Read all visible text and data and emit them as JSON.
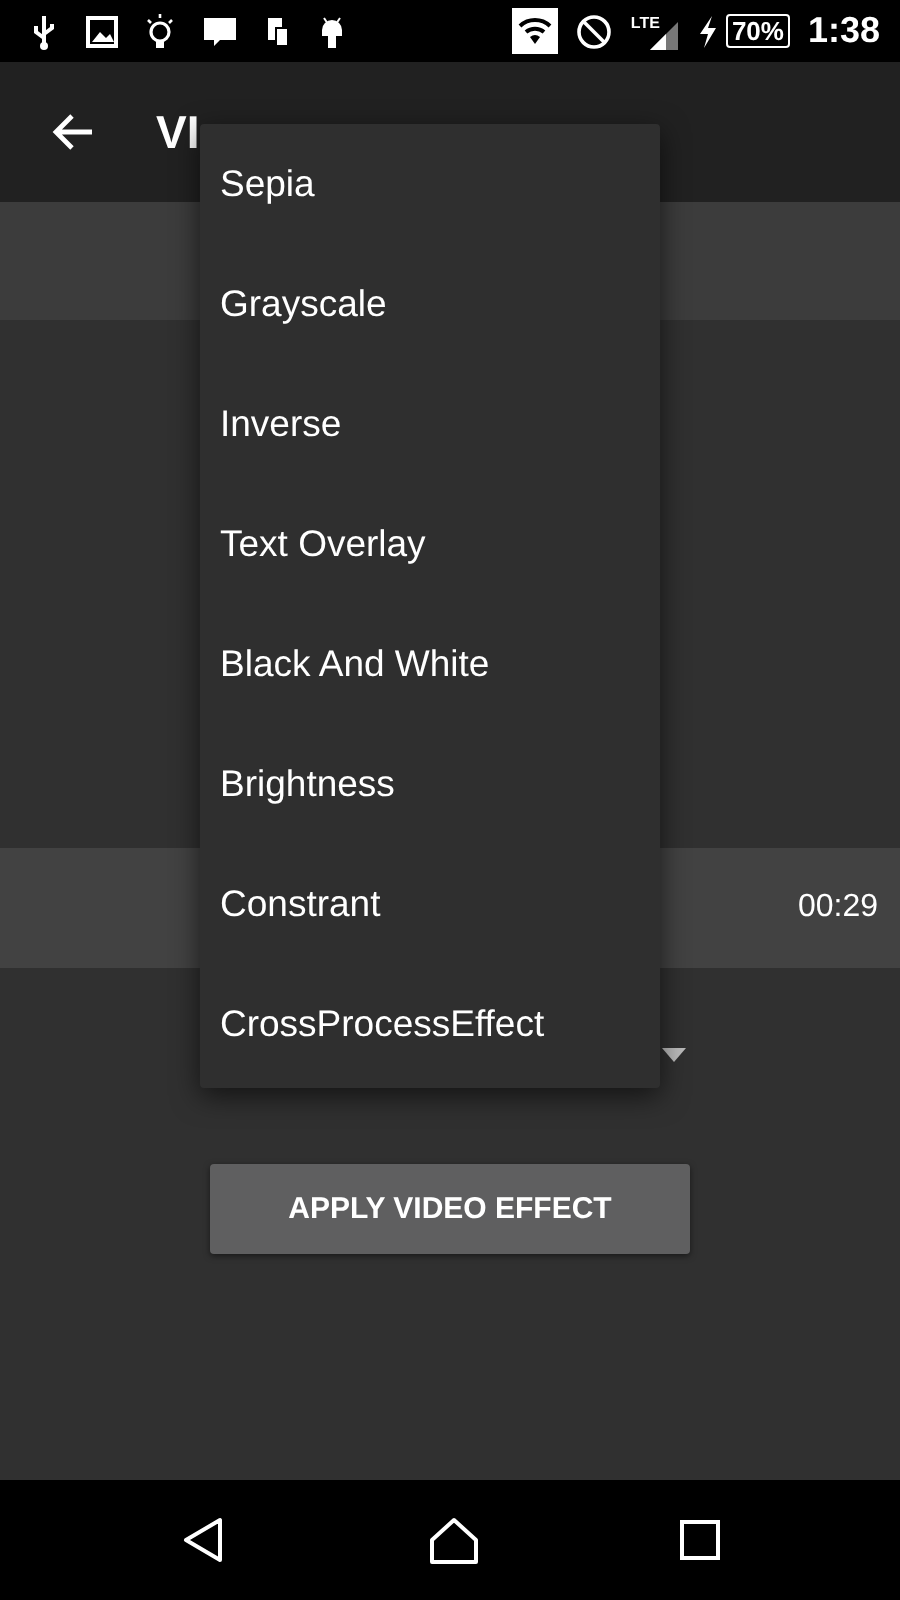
{
  "status_bar": {
    "network": "LTE",
    "battery": "70%",
    "time": "1:38"
  },
  "app_bar": {
    "title": "VI"
  },
  "video_row": {
    "duration": "00:29"
  },
  "effect_menu": {
    "items": [
      {
        "label": "Sepia"
      },
      {
        "label": "Grayscale"
      },
      {
        "label": "Inverse"
      },
      {
        "label": "Text Overlay"
      },
      {
        "label": "Black And White"
      },
      {
        "label": "Brightness"
      },
      {
        "label": "Constrant"
      },
      {
        "label": "CrossProcessEffect"
      }
    ]
  },
  "apply_button": {
    "label": "APPLY VIDEO EFFECT"
  }
}
